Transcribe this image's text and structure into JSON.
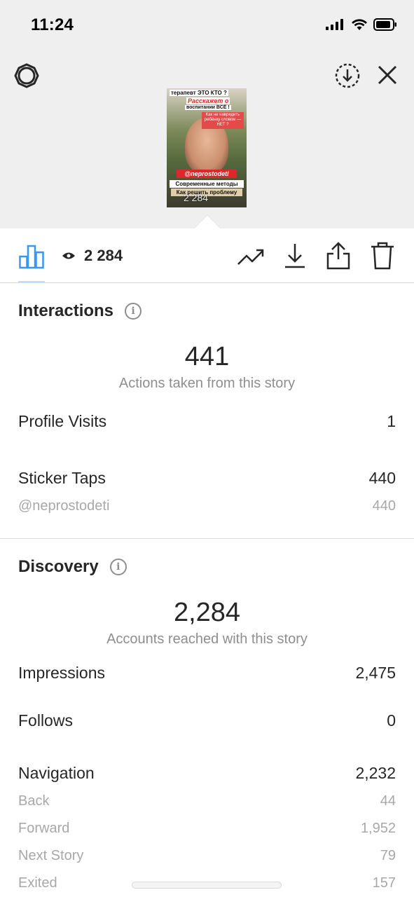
{
  "status_bar": {
    "time": "11:24"
  },
  "story_thumbnail": {
    "text_line1": "терапевт ЭТО КТО ?",
    "text_line2": "Расскажет о",
    "text_line3": "воспитании ВСЁ !",
    "text_line4": "Как не навредить ребёнку словом — НЕТ ?",
    "handle": "@neprostodeti",
    "text_line5": "Современные методы",
    "text_line6": "Как решить проблему",
    "overlay_views": "2 284"
  },
  "toolbar": {
    "views_count": "2 284"
  },
  "interactions": {
    "title": "Interactions",
    "total": "441",
    "caption": "Actions taken from this story",
    "rows": [
      {
        "label": "Profile Visits",
        "value": "1"
      },
      {
        "label": "Sticker Taps",
        "value": "440"
      }
    ],
    "sub_rows": [
      {
        "label": "@neprostodeti",
        "value": "440"
      }
    ]
  },
  "discovery": {
    "title": "Discovery",
    "total": "2,284",
    "caption": "Accounts reached with this story",
    "impressions": {
      "label": "Impressions",
      "value": "2,475"
    },
    "follows": {
      "label": "Follows",
      "value": "0"
    },
    "navigation": {
      "label": "Navigation",
      "value": "2,232"
    },
    "nav_breakdown": [
      {
        "label": "Back",
        "value": "44"
      },
      {
        "label": "Forward",
        "value": "1,952"
      },
      {
        "label": "Next Story",
        "value": "79"
      },
      {
        "label": "Exited",
        "value": "157"
      }
    ]
  },
  "colors": {
    "accent_blue": "#3897f0",
    "text_primary": "#262626",
    "text_secondary": "#8e8e8e"
  },
  "icons": [
    "settings-icon",
    "download-circle-icon",
    "close-icon",
    "bar-chart-icon",
    "eye-icon",
    "trending-icon",
    "download-icon",
    "share-icon",
    "trash-icon",
    "info-icon"
  ]
}
